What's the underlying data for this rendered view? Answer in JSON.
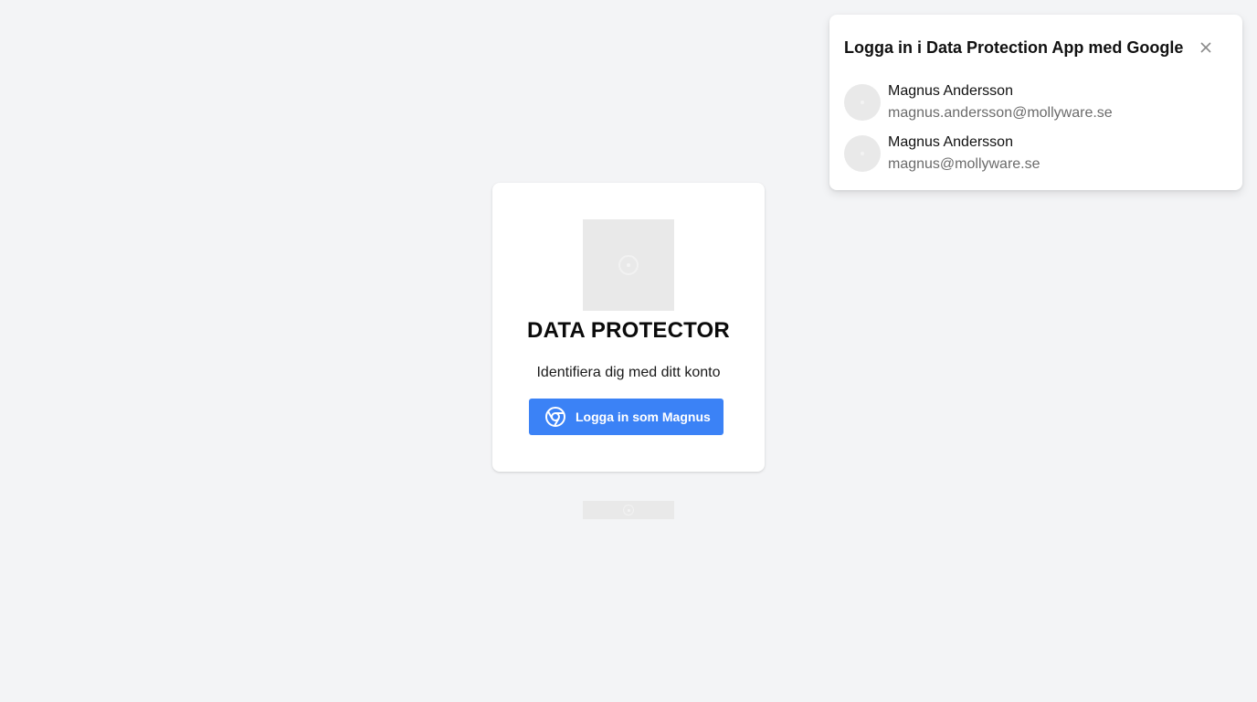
{
  "login_card": {
    "title": "DATA PROTECTOR",
    "subtitle": "Identifiera dig med ditt konto",
    "signin_button_label": "Logga in som Magnus",
    "signin_button_icon": "google-chrome-icon",
    "logo_icon": "image-placeholder-icon"
  },
  "footer": {
    "icon": "image-placeholder-icon"
  },
  "google_popup": {
    "title": "Logga in i Data Protection App med Google",
    "close_icon": "close-icon",
    "accounts": [
      {
        "name": "Magnus Andersson",
        "email": "magnus.andersson@mollyware.se"
      },
      {
        "name": "Magnus Andersson",
        "email": "magnus@mollyware.se"
      }
    ]
  },
  "colors": {
    "background": "#f3f4f6",
    "primary_button": "#3b82f6",
    "placeholder": "#e9e9e9",
    "email_text": "#6b6b6b"
  }
}
